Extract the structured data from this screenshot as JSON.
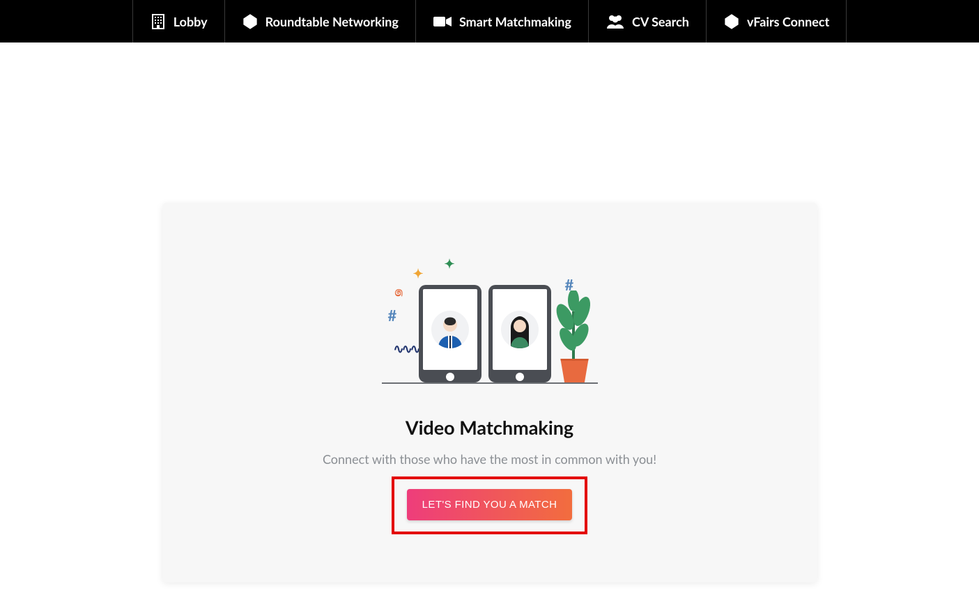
{
  "nav": {
    "items": [
      {
        "label": "Lobby",
        "icon": "building-icon"
      },
      {
        "label": "Roundtable Networking",
        "icon": "polyhedron-icon"
      },
      {
        "label": "Smart Matchmaking",
        "icon": "video-camera-icon"
      },
      {
        "label": "CV Search",
        "icon": "users-icon"
      },
      {
        "label": "vFairs Connect",
        "icon": "polyhedron-icon"
      }
    ]
  },
  "card": {
    "title": "Video Matchmaking",
    "subtitle": "Connect with those who have the most in common with you!",
    "cta_label": "LET'S FIND YOU A MATCH",
    "illustration": {
      "phones": [
        {
          "avatar": "man-suit"
        },
        {
          "avatar": "woman-long-hair"
        }
      ],
      "decorations": [
        "star",
        "squiggle",
        "hash",
        "hash",
        "star",
        "wave"
      ]
    }
  },
  "highlight": {
    "target": "cta-button",
    "color": "#e30000"
  }
}
